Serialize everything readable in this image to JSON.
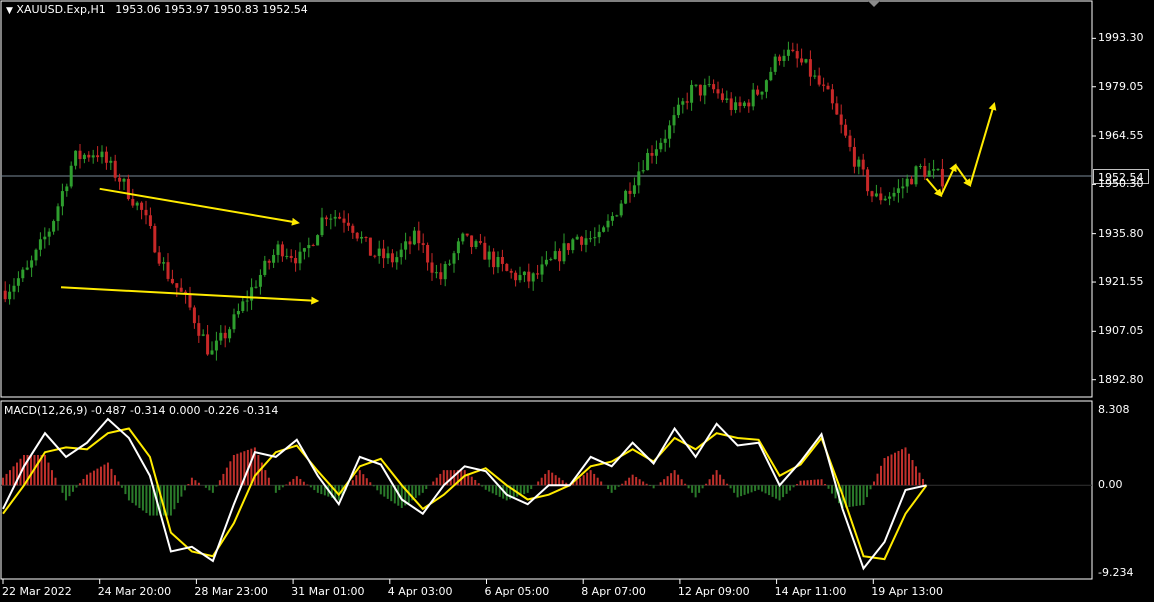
{
  "header": {
    "symbol": "XAUUSD.Exp,H1",
    "ohlc": "1953.06 1953.97 1950.83 1952.54",
    "menu_icon": "triangle-down-icon"
  },
  "macd_header": {
    "label": "MACD(12,26,9) -0.487 -0.314 0.000 -0.226 -0.314"
  },
  "chart_data": {
    "type": "candlestick",
    "symbol": "XAUUSD.Exp",
    "timeframe": "H1",
    "last_price": "1952.54",
    "price_ticks": [
      "1993.30",
      "1979.05",
      "1964.55",
      "1950.30",
      "1935.80",
      "1921.55",
      "1907.05",
      "1892.80"
    ],
    "ylim": [
      1888,
      2004
    ],
    "time_ticks": [
      "22 Mar 2022",
      "24 Mar 20:00",
      "28 Mar 23:00",
      "31 Mar 01:00",
      "4 Apr 03:00",
      "6 Apr 05:00",
      "8 Apr 07:00",
      "12 Apr 09:00",
      "14 Apr 11:00",
      "19 Apr 13:00"
    ],
    "close_path": [
      [
        1921,
        1919
      ],
      [
        1928,
        1925
      ],
      [
        1942,
        1938
      ],
      [
        1964,
        1958
      ],
      [
        1962,
        1960
      ],
      [
        1958,
        1952
      ],
      [
        1948,
        1942
      ],
      [
        1932,
        1925
      ],
      [
        1922,
        1915
      ],
      [
        1906,
        1900
      ],
      [
        1912,
        1910
      ],
      [
        1925,
        1922
      ],
      [
        1935,
        1932
      ],
      [
        1930,
        1928
      ],
      [
        1938,
        1942
      ],
      [
        1944,
        1940
      ],
      [
        1935,
        1930
      ],
      [
        1926,
        1928
      ],
      [
        1932,
        1935
      ],
      [
        1928,
        1922
      ],
      [
        1930,
        1934
      ],
      [
        1932,
        1930
      ],
      [
        1926,
        1924
      ],
      [
        1922,
        1922
      ],
      [
        1926,
        1928
      ],
      [
        1932,
        1935
      ],
      [
        1930,
        1934
      ],
      [
        1938,
        1946
      ],
      [
        1952,
        1958
      ],
      [
        1958,
        1966
      ],
      [
        1972,
        1978
      ],
      [
        1980,
        1978
      ],
      [
        1976,
        1972
      ],
      [
        1970,
        1978
      ],
      [
        1986,
        1990
      ],
      [
        1996,
        1985
      ],
      [
        1980,
        1976
      ],
      [
        1975,
        1960
      ],
      [
        1952,
        1946
      ],
      [
        1944,
        1948
      ],
      [
        1952,
        1955
      ],
      [
        1955,
        1952
      ]
    ],
    "annotations": {
      "upper_trendline": {
        "from": [
          1,
          1949
        ],
        "to": [
          3.05,
          1939
        ]
      },
      "lower_trendline": {
        "from": [
          0.6,
          1920
        ],
        "to": [
          3.25,
          1916
        ]
      },
      "projection_arrows": [
        [
          9.55,
          1952
        ],
        [
          9.7,
          1947
        ],
        [
          9.85,
          1956
        ],
        [
          10.0,
          1950
        ],
        [
          10.25,
          1974
        ]
      ]
    },
    "macd": {
      "params": "12,26,9",
      "values": [
        "-0.487",
        "-0.314",
        "0.000",
        "-0.226",
        "-0.314"
      ],
      "ticks": [
        "8.308",
        "0.00",
        "-9.234"
      ],
      "ylim": [
        -9.8,
        8.8
      ],
      "main": [
        -2.5,
        2,
        5.5,
        3,
        4.5,
        7,
        5,
        1,
        -7,
        -6.5,
        -8,
        -2,
        3.5,
        3,
        4.8,
        1,
        -2,
        3,
        2.2,
        -1.5,
        -3,
        0,
        2,
        1.5,
        -1,
        -2,
        0,
        0,
        3,
        2,
        4.5,
        2.3,
        6,
        3,
        6.5,
        4.2,
        4.5,
        0,
        2.5,
        5.4,
        -2.5,
        -8.8,
        -6,
        -0.5,
        0
      ],
      "signal": [
        -3,
        0,
        3.5,
        4,
        3.8,
        5.5,
        6,
        3,
        -5,
        -7,
        -7.5,
        -4,
        1,
        3.5,
        4.2,
        1.5,
        -1,
        2,
        2.8,
        0,
        -2.5,
        -1,
        1,
        1.8,
        0,
        -1.5,
        -1,
        0,
        2,
        2.5,
        3.8,
        2.5,
        5,
        3.8,
        5.5,
        5,
        4.8,
        1,
        2.2,
        5,
        -1,
        -7.5,
        -7.8,
        -3,
        0
      ]
    },
    "colors": {
      "up": "#2e9e2e",
      "down": "#c82828",
      "macd_main": "#ffffff",
      "macd_signal": "#ffeb00",
      "hist_pos": "#c0302c",
      "hist_neg": "#2a7a2a",
      "annotation": "#ffeb00"
    }
  }
}
